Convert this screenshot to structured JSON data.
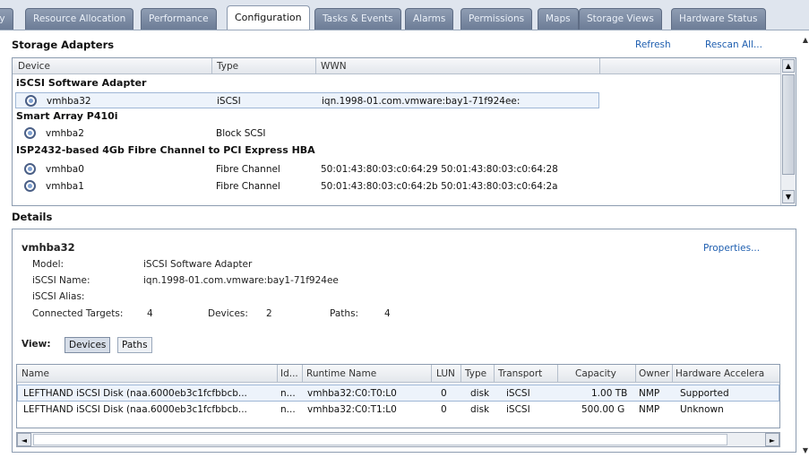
{
  "tabs": [
    {
      "label": "ry",
      "active": false
    },
    {
      "label": "Resource Allocation",
      "active": false
    },
    {
      "label": "Performance",
      "active": false
    },
    {
      "label": "Configuration",
      "active": true
    },
    {
      "label": "Tasks & Events",
      "active": false
    },
    {
      "label": "Alarms",
      "active": false
    },
    {
      "label": "Permissions",
      "active": false
    },
    {
      "label": "Maps",
      "active": false
    },
    {
      "label": "Storage Views",
      "active": false
    },
    {
      "label": "Hardware Status",
      "active": false
    }
  ],
  "storage": {
    "title": "Storage Adapters",
    "refresh": "Refresh",
    "rescan": "Rescan All...",
    "columns": {
      "device": "Device",
      "type": "Type",
      "wwn": "WWN"
    },
    "groups": [
      {
        "name": "iSCSI Software Adapter",
        "rows": [
          {
            "device": "vmhba32",
            "type": "iSCSI",
            "wwn": "iqn.1998-01.com.vmware:bay1-71f924ee:"
          }
        ]
      },
      {
        "name": "Smart Array P410i",
        "rows": [
          {
            "device": "vmhba2",
            "type": "Block SCSI",
            "wwn": ""
          }
        ]
      },
      {
        "name": "ISP2432-based 4Gb Fibre Channel to PCI Express HBA",
        "rows": [
          {
            "device": "vmhba0",
            "type": "Fibre Channel",
            "wwn": "50:01:43:80:03:c0:64:29 50:01:43:80:03:c0:64:28"
          },
          {
            "device": "vmhba1",
            "type": "Fibre Channel",
            "wwn": "50:01:43:80:03:c0:64:2b 50:01:43:80:03:c0:64:2a"
          }
        ]
      }
    ]
  },
  "details": {
    "title": "Details",
    "adapter": "vmhba32",
    "properties": "Properties...",
    "model_label": "Model:",
    "model": "iSCSI Software Adapter",
    "iscsi_name_label": "iSCSI Name:",
    "iscsi_name": "iqn.1998-01.com.vmware:bay1-71f924ee",
    "iscsi_alias_label": "iSCSI Alias:",
    "iscsi_alias": "",
    "targets_label": "Connected Targets:",
    "targets": "4",
    "devices_label": "Devices:",
    "devices": "2",
    "paths_label": "Paths:",
    "paths": "4",
    "view_label": "View:",
    "view_devices": "Devices",
    "view_paths": "Paths",
    "columns": {
      "name": "Name",
      "id": "Id...",
      "runtime": "Runtime Name",
      "lun": "LUN",
      "type": "Type",
      "transport": "Transport",
      "capacity": "Capacity",
      "owner": "Owner",
      "hwaccel": "Hardware Accelera"
    },
    "rows": [
      {
        "name": "LEFTHAND iSCSI Disk (naa.6000eb3c1fcfbbcb...",
        "id": "n...",
        "runtime": "vmhba32:C0:T0:L0",
        "lun": "0",
        "type": "disk",
        "transport": "iSCSI",
        "capacity": "1.00 TB",
        "owner": "NMP",
        "hwaccel": "Supported"
      },
      {
        "name": "LEFTHAND iSCSI Disk (naa.6000eb3c1fcfbbcb...",
        "id": "n...",
        "runtime": "vmhba32:C0:T1:L0",
        "lun": "0",
        "type": "disk",
        "transport": "iSCSI",
        "capacity": "500.00 G",
        "owner": "NMP",
        "hwaccel": "Unknown"
      }
    ]
  }
}
